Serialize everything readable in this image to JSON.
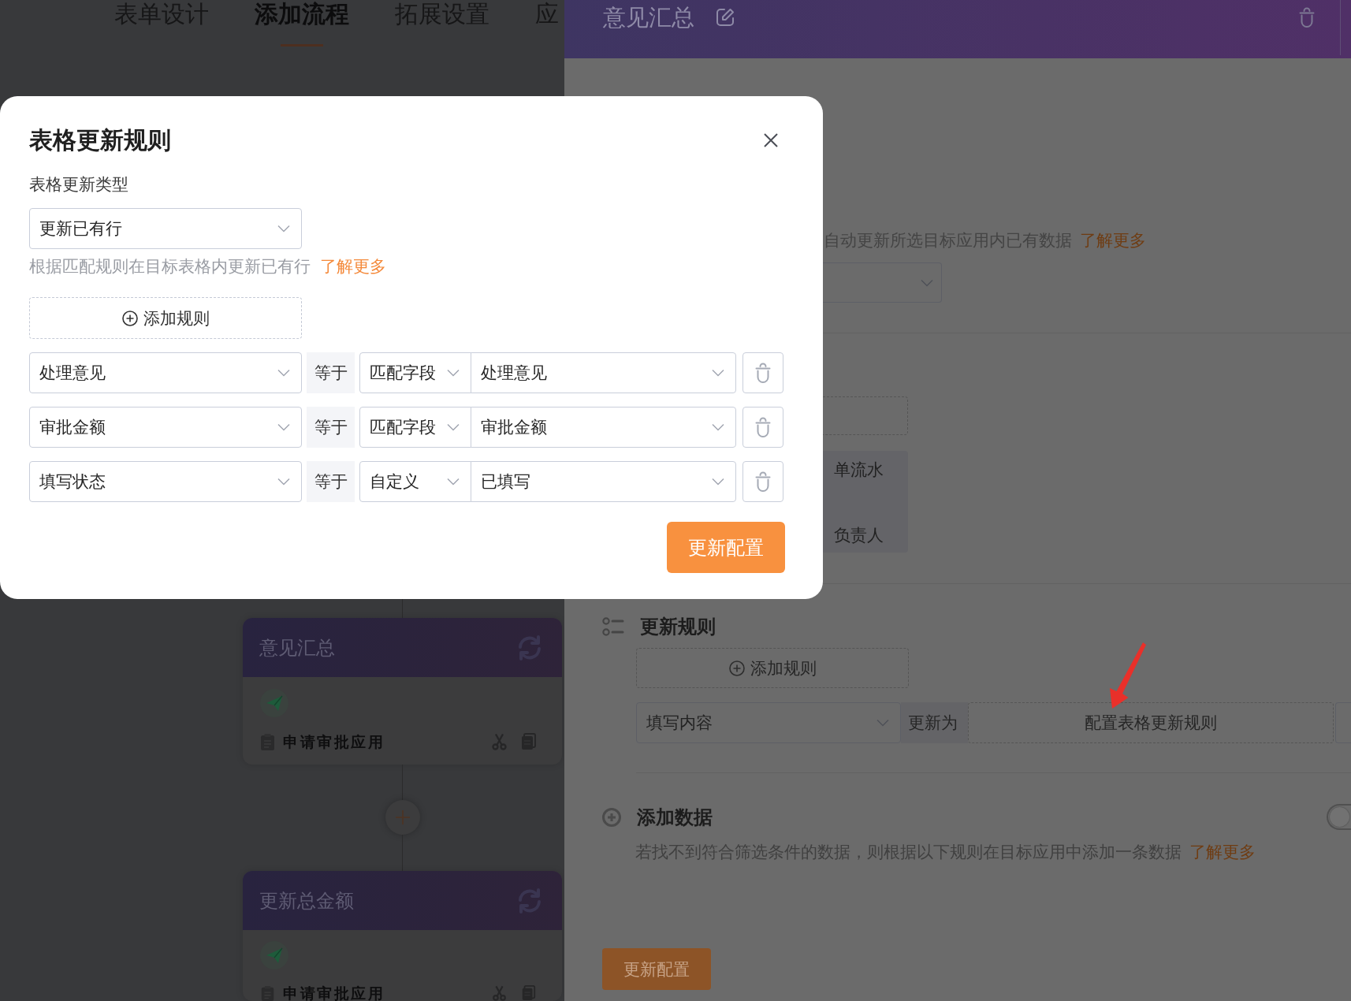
{
  "flow_editor": {
    "tabs": [
      {
        "label": "表单设计",
        "selected": false
      },
      {
        "label": "添加流程",
        "selected": true
      },
      {
        "label": "拓展设置",
        "selected": false
      },
      {
        "label": "应",
        "selected": false
      }
    ],
    "nodes": [
      {
        "title": "意见汇总",
        "app": "申请审批应用"
      },
      {
        "title": "更新总金额",
        "app": "申请审批应用"
      }
    ]
  },
  "node_panel": {
    "title": "意见汇总",
    "update_hint": "自动更新所选目标应用内已有数据",
    "update_hint_link": "了解更多",
    "condition_texts": [
      "单流水",
      "负责人"
    ],
    "update_rules": {
      "title": "更新规则",
      "add_button": "添加规则",
      "rows": [
        {
          "field": "填写内容",
          "operator": "更新为",
          "value": "配置表格更新规则"
        }
      ]
    },
    "add_data": {
      "title": "添加数据",
      "enabled": false,
      "description": "若找不到符合筛选条件的数据，则根据以下规则在目标应用中添加一条数据",
      "link": "了解更多"
    },
    "save_button": "更新配置"
  },
  "dialog": {
    "title": "表格更新规则",
    "type_label": "表格更新类型",
    "type_value": "更新已有行",
    "hint": "根据匹配规则在目标表格内更新已有行",
    "hint_link": "了解更多",
    "add_button": "添加规则",
    "rules": [
      {
        "field": "处理意见",
        "operator": "等于",
        "source": "匹配字段",
        "value": "处理意见"
      },
      {
        "field": "审批金额",
        "operator": "等于",
        "source": "匹配字段",
        "value": "审批金额"
      },
      {
        "field": "填写状态",
        "operator": "等于",
        "source": "自定义",
        "value": "已填写"
      }
    ],
    "submit_button": "更新配置"
  }
}
